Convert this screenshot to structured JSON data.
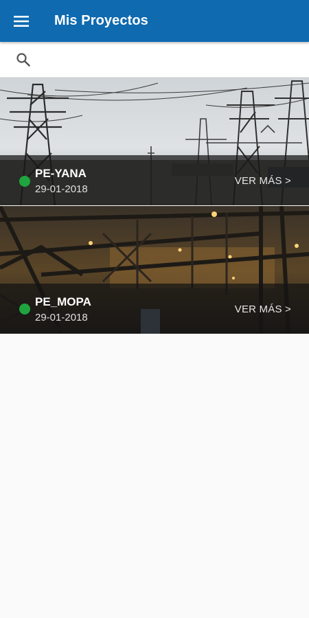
{
  "app": {
    "title": "Mis Proyectos",
    "primary_color": "#0f6ab0",
    "menu_icon": "menu-icon"
  },
  "search": {
    "icon": "search-icon",
    "value": "",
    "placeholder": ""
  },
  "projects": [
    {
      "name": "PE-YANA",
      "date": "29-01-2018",
      "action": "VER MÁS  >",
      "status_color": "#1ea53f",
      "image": "transmission towers substation"
    },
    {
      "name": "PE_MOPA",
      "date": "29-01-2018",
      "action": "VER MÁS  >",
      "status_color": "#1ea53f",
      "image": "industrial steel structure at night"
    }
  ]
}
